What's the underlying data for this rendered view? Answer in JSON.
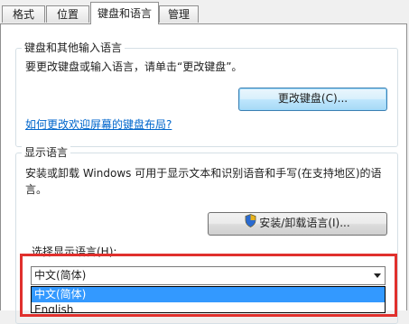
{
  "tabs": [
    {
      "label": "格式"
    },
    {
      "label": "位置"
    },
    {
      "label": "键盘和语言"
    },
    {
      "label": "管理"
    }
  ],
  "keyboards": {
    "legend": "键盘和其他输入语言",
    "description": "要更改键盘或输入语言，请单击“更改键盘”。",
    "change_button": "更改键盘(C)...",
    "help_link": "如何更改欢迎屏幕的键盘布局?"
  },
  "display_language": {
    "legend": "显示语言",
    "description_line1": "安装或卸载 Windows 可用于显示文本和识别语音和手写(在支持地区)的语",
    "description_line2": "言。",
    "install_button": "安装/卸载语言(I)...",
    "choose_label": "选择显示语言(H):",
    "selected": "中文(简体)",
    "options": [
      "中文(简体)",
      "English"
    ]
  },
  "colors": {
    "highlight_box": "#e0302d",
    "selection": "#3399ff",
    "link": "#0066cc"
  },
  "icons": {
    "install_button_icon": "shield-icon",
    "dropdown_icon": "chevron-down-icon"
  }
}
